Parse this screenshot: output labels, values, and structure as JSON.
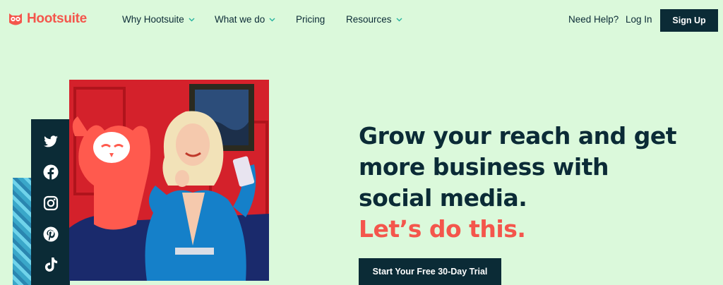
{
  "brand": {
    "name": "Hootsuite",
    "accent": "#f4564c",
    "dark": "#0b2b36",
    "background": "#dbf9db"
  },
  "nav": {
    "items": [
      {
        "label": "Why Hootsuite",
        "has_dropdown": true
      },
      {
        "label": "What we do",
        "has_dropdown": true
      },
      {
        "label": "Pricing",
        "has_dropdown": false
      },
      {
        "label": "Resources",
        "has_dropdown": true
      }
    ],
    "help": "Need Help?",
    "login": "Log In",
    "signup": "Sign Up"
  },
  "social": {
    "icons": [
      "twitter-icon",
      "facebook-icon",
      "instagram-icon",
      "pinterest-icon",
      "tiktok-icon"
    ]
  },
  "hero": {
    "headline_lines": [
      "Grow your reach and get",
      "more business with",
      "social media."
    ],
    "tagline": "Let’s do this.",
    "cta": "Start Your Free 30-Day Trial"
  }
}
